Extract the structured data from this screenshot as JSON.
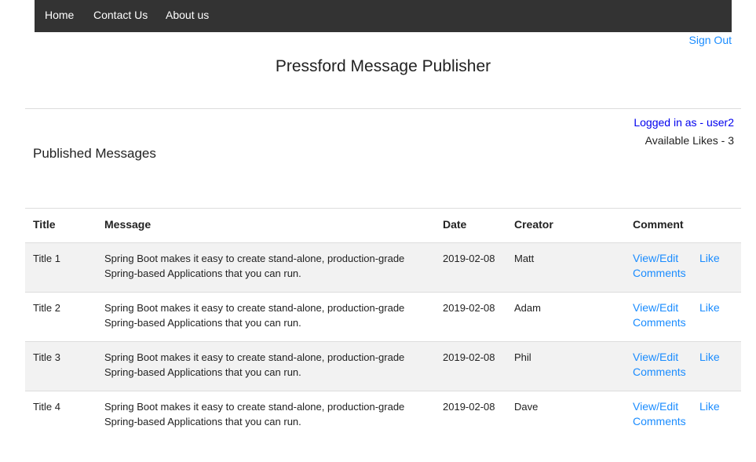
{
  "nav": {
    "items": [
      "Home",
      "Contact Us",
      "About us"
    ],
    "sign_out": "Sign Out"
  },
  "header": {
    "title": "Pressford Message Publisher"
  },
  "user": {
    "logged_in": "Logged in as - user2",
    "available_likes": "Available Likes - 3"
  },
  "section_title": "Published Messages",
  "table": {
    "columns": [
      "Title",
      "Message",
      "Date",
      "Creator",
      "Comment"
    ],
    "rows": [
      {
        "title": "Title 1",
        "message": "Spring Boot makes it easy to create stand-alone, production-grade Spring-based Applications that you can run.",
        "date": "2019-02-08",
        "creator": "Matt",
        "comment_link": "View/Edit Comments",
        "like": "Like"
      },
      {
        "title": "Title 2",
        "message": "Spring Boot makes it easy to create stand-alone, production-grade Spring-based Applications that you can run.",
        "date": "2019-02-08",
        "creator": "Adam",
        "comment_link": "View/Edit Comments",
        "like": "Like"
      },
      {
        "title": "Title 3",
        "message": "Spring Boot makes it easy to create stand-alone, production-grade Spring-based Applications that you can run.",
        "date": "2019-02-08",
        "creator": "Phil",
        "comment_link": "View/Edit Comments",
        "like": "Like"
      },
      {
        "title": "Title 4",
        "message": "Spring Boot makes it easy to create stand-alone, production-grade Spring-based Applications that you can run.",
        "date": "2019-02-08",
        "creator": "Dave",
        "comment_link": "View/Edit Comments",
        "like": "Like"
      }
    ]
  }
}
